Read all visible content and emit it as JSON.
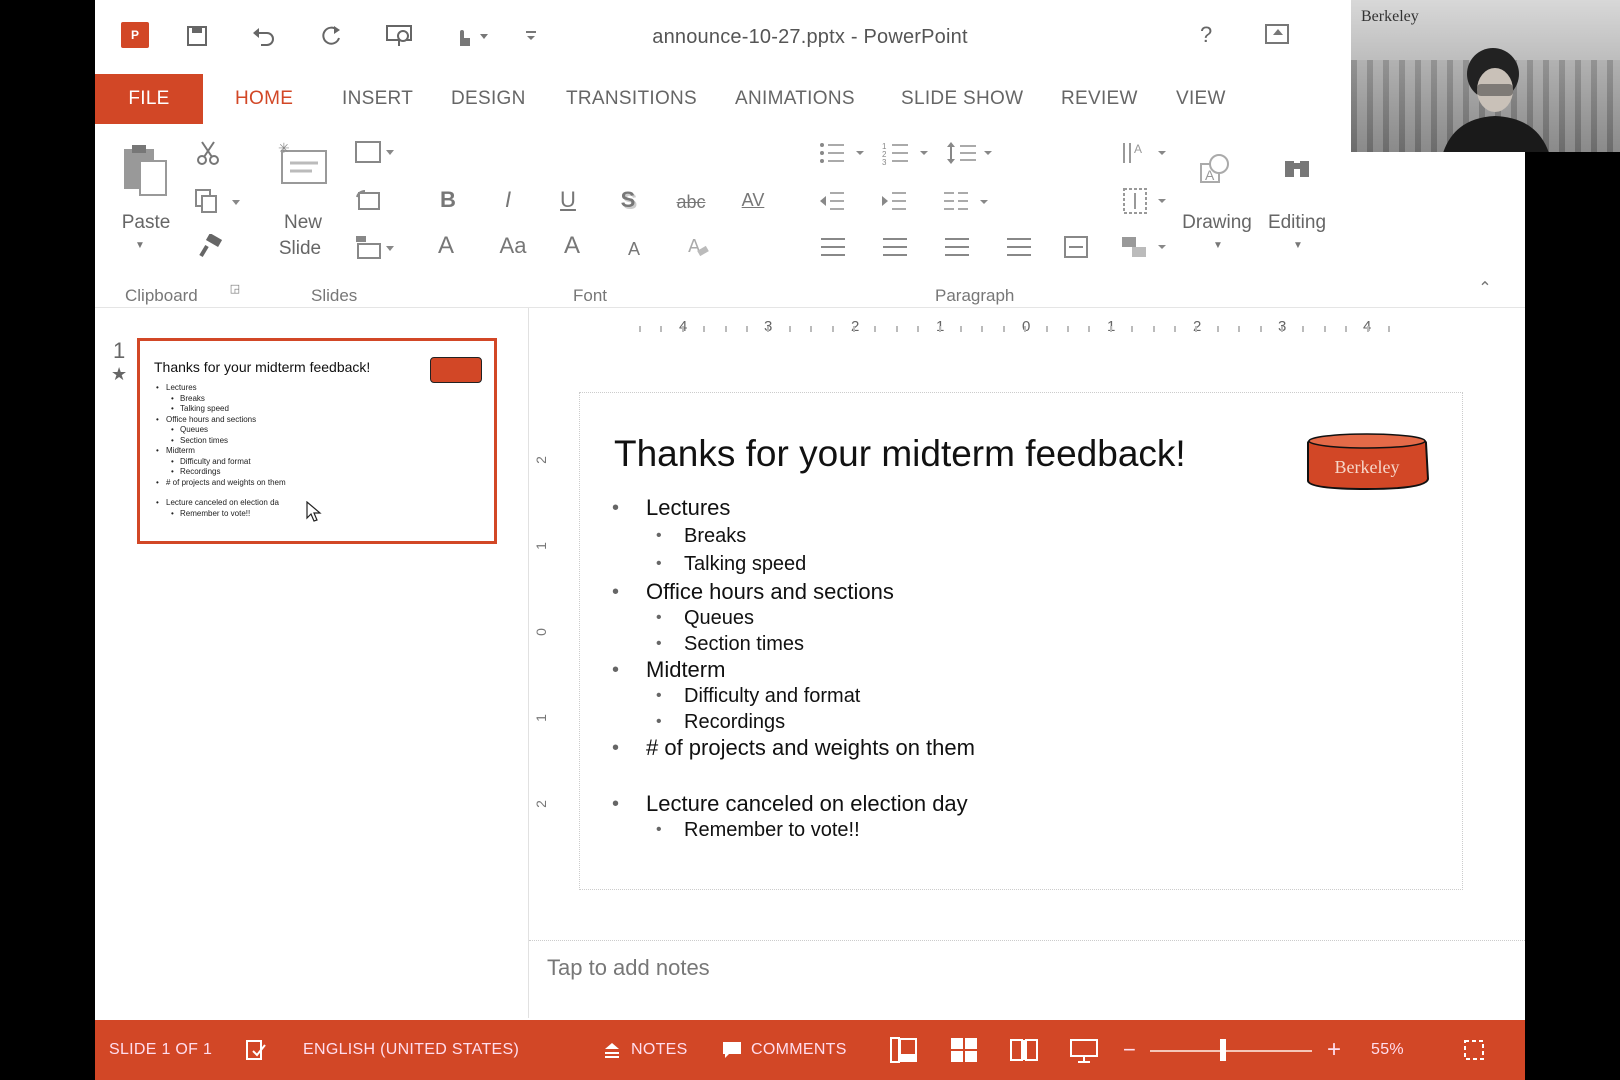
{
  "window": {
    "title": "announce-10-27.pptx - PowerPoint",
    "help": "?"
  },
  "tabs": [
    {
      "label": "FILE"
    },
    {
      "label": "HOME"
    },
    {
      "label": "INSERT"
    },
    {
      "label": "DESIGN"
    },
    {
      "label": "TRANSITIONS"
    },
    {
      "label": "ANIMATIONS"
    },
    {
      "label": "SLIDE SHOW"
    },
    {
      "label": "REVIEW"
    },
    {
      "label": "VIEW"
    }
  ],
  "ribbon": {
    "paste": "Paste",
    "new_slide_1": "New",
    "new_slide_2": "Slide",
    "drawing": "Drawing",
    "editing": "Editing",
    "groups": {
      "clipboard": "Clipboard",
      "slides": "Slides",
      "font": "Font",
      "paragraph": "Paragraph"
    },
    "font_buttons": {
      "bold": "B",
      "italic": "I",
      "underline": "U",
      "shadow": "S",
      "strike": "abc",
      "spacing": "AV",
      "color": "A",
      "case": "Aa",
      "grow": "A",
      "shrink": "A"
    }
  },
  "ruler": {
    "numbers": [
      "4",
      "3",
      "2",
      "1",
      "0",
      "1",
      "2",
      "3",
      "4"
    ],
    "vertical": [
      "2",
      "1",
      "0",
      "1",
      "2"
    ]
  },
  "thumbnail": {
    "number": "1",
    "title": "Thanks for your midterm feedback!",
    "items": [
      {
        "text": "Lectures",
        "level": 1
      },
      {
        "text": "Breaks",
        "level": 2
      },
      {
        "text": "Talking speed",
        "level": 2
      },
      {
        "text": "Office hours and sections",
        "level": 1
      },
      {
        "text": "Queues",
        "level": 2
      },
      {
        "text": "Section times",
        "level": 2
      },
      {
        "text": "Midterm",
        "level": 1
      },
      {
        "text": "Difficulty and format",
        "level": 2
      },
      {
        "text": "Recordings",
        "level": 2
      },
      {
        "text": "# of projects and weights on them",
        "level": 1
      },
      {
        "text": "Lecture canceled on election da",
        "level": 1
      },
      {
        "text": "Remember to vote!!",
        "level": 2
      }
    ]
  },
  "slide": {
    "title": "Thanks for your midterm feedback!",
    "logo_text": "Berkeley",
    "bullets": [
      {
        "text": "Lectures",
        "level": 1
      },
      {
        "text": "Breaks",
        "level": 2
      },
      {
        "text": "Talking speed",
        "level": 2
      },
      {
        "text": "Office hours and sections",
        "level": 1
      },
      {
        "text": "Queues",
        "level": 2
      },
      {
        "text": "Section times",
        "level": 2
      },
      {
        "text": "Midterm",
        "level": 1
      },
      {
        "text": "Difficulty and format",
        "level": 2
      },
      {
        "text": "Recordings",
        "level": 2
      },
      {
        "text": "# of projects and weights on them",
        "level": 1
      },
      {
        "text": "Lecture canceled on election day",
        "level": 1
      },
      {
        "text": "Remember to vote!!",
        "level": 2
      }
    ]
  },
  "notes": {
    "placeholder": "Tap to add notes"
  },
  "status": {
    "slide": "SLIDE 1 OF 1",
    "language": "ENGLISH (UNITED STATES)",
    "notes": "NOTES",
    "comments": "COMMENTS",
    "zoom_minus": "−",
    "zoom_plus": "+",
    "zoom": "55%"
  },
  "webcam": {
    "sign_text": "Berkeley"
  },
  "colors": {
    "accent": "#d24726"
  }
}
